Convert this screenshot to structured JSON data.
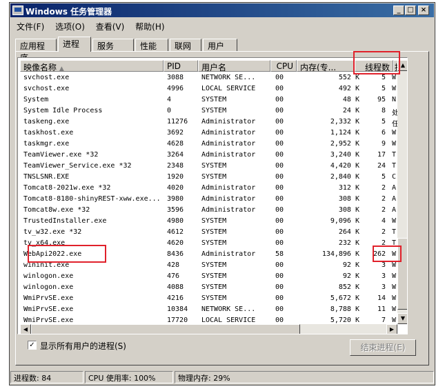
{
  "window": {
    "title": "Windows 任务管理器",
    "controls": {
      "minimize": "_",
      "maximize": "□",
      "close": "×"
    }
  },
  "menu": [
    "文件(F)",
    "选项(O)",
    "查看(V)",
    "帮助(H)"
  ],
  "tabs": [
    "应用程序",
    "进程",
    "服务",
    "性能",
    "联网",
    "用户"
  ],
  "active_tab": "进程",
  "columns": {
    "name": "映像名称",
    "pid": "PID",
    "user": "用户名",
    "cpu": "CPU",
    "memory": "内存(专...",
    "threads": "线程数",
    "extra": "描"
  },
  "processes": [
    {
      "name": "svchost.exe",
      "pid": "3088",
      "user": "NETWORK SE...",
      "cpu": "00",
      "mem": "552 K",
      "threads": "5",
      "extra": "W"
    },
    {
      "name": "svchost.exe",
      "pid": "4996",
      "user": "LOCAL SERVICE",
      "cpu": "00",
      "mem": "492 K",
      "threads": "5",
      "extra": "W"
    },
    {
      "name": "System",
      "pid": "4",
      "user": "SYSTEM",
      "cpu": "00",
      "mem": "48 K",
      "threads": "95",
      "extra": "N"
    },
    {
      "name": "System Idle Process",
      "pid": "0",
      "user": "SYSTEM",
      "cpu": "00",
      "mem": "24 K",
      "threads": "8",
      "extra": "处"
    },
    {
      "name": "taskeng.exe",
      "pid": "11276",
      "user": "Administrator",
      "cpu": "00",
      "mem": "2,332 K",
      "threads": "5",
      "extra": "任"
    },
    {
      "name": "taskhost.exe",
      "pid": "3692",
      "user": "Administrator",
      "cpu": "00",
      "mem": "1,124 K",
      "threads": "6",
      "extra": "W"
    },
    {
      "name": "taskmgr.exe",
      "pid": "4628",
      "user": "Administrator",
      "cpu": "00",
      "mem": "2,952 K",
      "threads": "9",
      "extra": "W"
    },
    {
      "name": "TeamViewer.exe *32",
      "pid": "3264",
      "user": "Administrator",
      "cpu": "00",
      "mem": "3,240 K",
      "threads": "17",
      "extra": "T"
    },
    {
      "name": "TeamViewer_Service.exe *32",
      "pid": "2348",
      "user": "SYSTEM",
      "cpu": "00",
      "mem": "4,420 K",
      "threads": "24",
      "extra": "T"
    },
    {
      "name": "TNSLSNR.EXE",
      "pid": "1920",
      "user": "SYSTEM",
      "cpu": "00",
      "mem": "2,840 K",
      "threads": "5",
      "extra": "C"
    },
    {
      "name": "Tomcat8-2021w.exe *32",
      "pid": "4020",
      "user": "Administrator",
      "cpu": "00",
      "mem": "312 K",
      "threads": "2",
      "extra": "A"
    },
    {
      "name": "Tomcat8-8180-shinyREST-xww.exe...",
      "pid": "3980",
      "user": "Administrator",
      "cpu": "00",
      "mem": "308 K",
      "threads": "2",
      "extra": "A"
    },
    {
      "name": "Tomcat8w.exe *32",
      "pid": "3596",
      "user": "Administrator",
      "cpu": "00",
      "mem": "308 K",
      "threads": "2",
      "extra": "A"
    },
    {
      "name": "TrustedInstaller.exe",
      "pid": "4980",
      "user": "SYSTEM",
      "cpu": "00",
      "mem": "9,096 K",
      "threads": "4",
      "extra": "W"
    },
    {
      "name": "tv_w32.exe *32",
      "pid": "4612",
      "user": "SYSTEM",
      "cpu": "00",
      "mem": "264 K",
      "threads": "2",
      "extra": "T"
    },
    {
      "name": "tv_x64.exe",
      "pid": "4620",
      "user": "SYSTEM",
      "cpu": "00",
      "mem": "232 K",
      "threads": "2",
      "extra": "T"
    },
    {
      "name": "WebApi2022.exe",
      "pid": "8436",
      "user": "Administrator",
      "cpu": "58",
      "mem": "134,896 K",
      "threads": "262",
      "extra": "W"
    },
    {
      "name": "wininit.exe",
      "pid": "428",
      "user": "SYSTEM",
      "cpu": "00",
      "mem": "92 K",
      "threads": "3",
      "extra": "W"
    },
    {
      "name": "winlogon.exe",
      "pid": "476",
      "user": "SYSTEM",
      "cpu": "00",
      "mem": "92 K",
      "threads": "3",
      "extra": "W"
    },
    {
      "name": "winlogon.exe",
      "pid": "4088",
      "user": "SYSTEM",
      "cpu": "00",
      "mem": "852 K",
      "threads": "3",
      "extra": "W"
    },
    {
      "name": "WmiPrvSE.exe",
      "pid": "4216",
      "user": "SYSTEM",
      "cpu": "00",
      "mem": "5,672 K",
      "threads": "14",
      "extra": "W"
    },
    {
      "name": "WmiPrvSE.exe",
      "pid": "10384",
      "user": "NETWORK SE...",
      "cpu": "00",
      "mem": "8,788 K",
      "threads": "11",
      "extra": "W"
    },
    {
      "name": "WmiPrvSE.exe",
      "pid": "17720",
      "user": "LOCAL SERVICE",
      "cpu": "00",
      "mem": "5,720 K",
      "threads": "7",
      "extra": "W"
    }
  ],
  "show_all_users": {
    "label": "显示所有用户的进程(S)",
    "checked": true,
    "mark": "✓"
  },
  "end_process_button": "结束进程(E)",
  "status": {
    "processes": "进程数: 84",
    "cpu": "CPU 使用率: 100%",
    "memory": "物理内存: 29%"
  },
  "scroll_glyphs": {
    "up": "▲",
    "down": "▼",
    "left": "◀",
    "right": "▶"
  },
  "highlight_color": "#e0202a"
}
